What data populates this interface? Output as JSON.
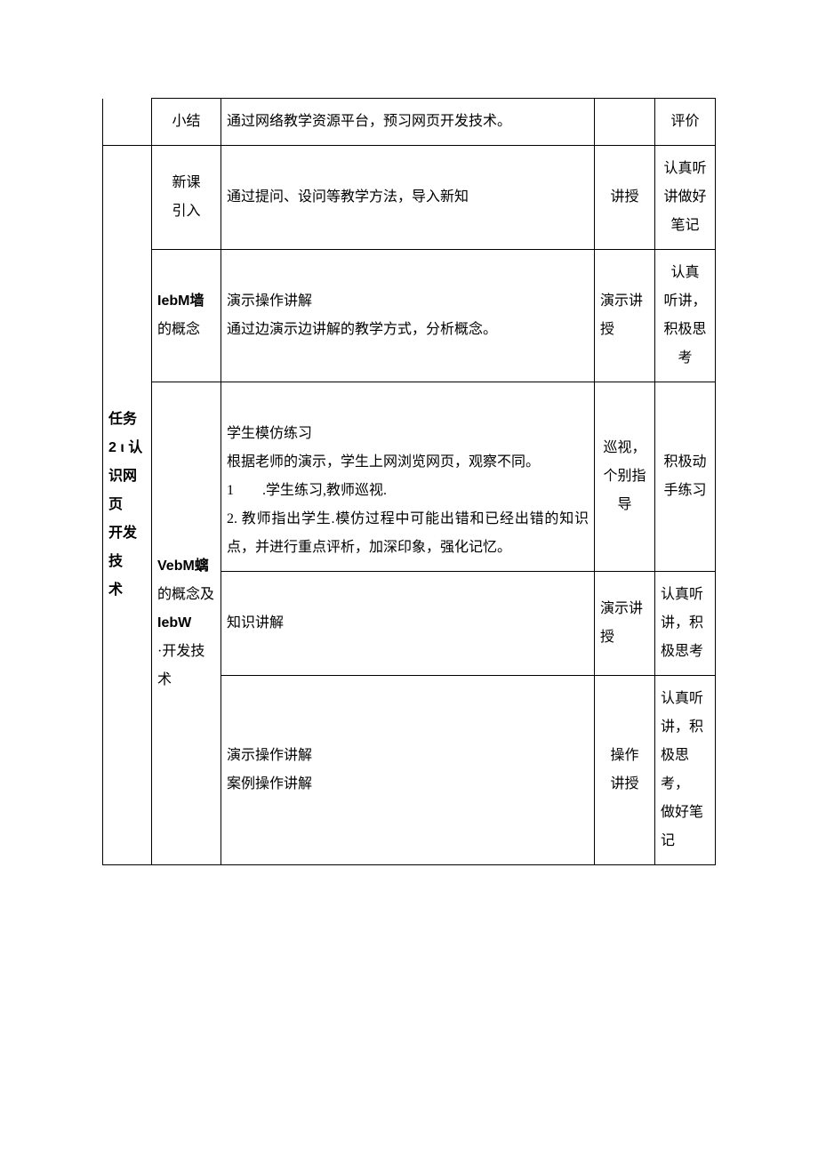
{
  "row0": {
    "c2": "小结",
    "c3": "通过网络教学资源平台，预习网页开发技术。",
    "c5": "评价"
  },
  "section": {
    "title_l1": "任务",
    "title_l2": "2 ι 认",
    "title_l3": "识网页",
    "title_l4": "开发技",
    "title_l5": "术"
  },
  "row1": {
    "c2_l1": "新课",
    "c2_l2": "引入",
    "c3": "通过提问、设问等教学方法，导入新知",
    "c4": "讲授",
    "c5_l1": "认真听",
    "c5_l2": "讲做好",
    "c5_l3": "笔记"
  },
  "row2": {
    "c2_l1": "IebM墙",
    "c2_l2": "的概念",
    "c3_l1": "演示操作讲解",
    "c3_l2": "通过边演示边讲解的教学方式，分析概念。",
    "c4_l1": "演示讲",
    "c4_l2": "授",
    "c5_l1": "认真",
    "c5_l2": "听讲，",
    "c5_l3": "积极思",
    "c5_l4": "考"
  },
  "row3": {
    "c3_l1": "学生模仿练习",
    "c3_l2": "根据老师的演示，学生上网浏览网页，观察不同。",
    "c3_l3a": "1",
    "c3_l3b": ".学生练习,教师巡视.",
    "c3_l4": "2. 教师指出学生.模仿过程中可能出错和已经出错的知识点，并进行重点评析，加深印象，强化记忆。",
    "c4_l1": "巡视，",
    "c4_l2": "个别指",
    "c4_l3": "导",
    "c5_l1": "积极动",
    "c5_l2": "手练习"
  },
  "col2span": {
    "l1": "VebM螭",
    "l2": "的概念及",
    "l3": "IebW",
    "l4": "·开发技",
    "l5": "术"
  },
  "row4": {
    "c3": "知识讲解",
    "c4_l1": "演示讲",
    "c4_l2": "授",
    "c5_l1": "认真听",
    "c5_l2": "讲，积",
    "c5_l3": "极思考"
  },
  "row5": {
    "c3_l1": "演示操作讲解",
    "c3_l2": "案例操作讲解",
    "c4_l1": "操作",
    "c4_l2": "讲授",
    "c5_l1": "认真听",
    "c5_l2": "讲，积",
    "c5_l3": "极思",
    "c5_l4": "考，",
    "c5_l5": "做好笔",
    "c5_l6": "记"
  }
}
